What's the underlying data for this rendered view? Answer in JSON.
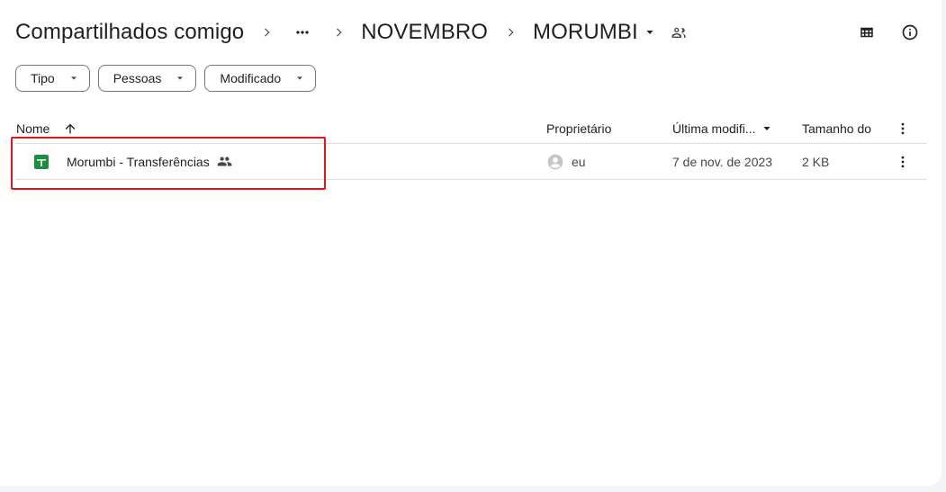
{
  "breadcrumb": {
    "root": "Compartilhados comigo",
    "more_label": "...",
    "folder1": "NOVEMBRO",
    "folder2": "MORUMBI"
  },
  "header_actions": {
    "grid_view_icon": "grid-view-icon",
    "details_icon": "info-icon"
  },
  "filters": [
    {
      "label": "Tipo"
    },
    {
      "label": "Pessoas"
    },
    {
      "label": "Modificado"
    }
  ],
  "table": {
    "columns": {
      "name": "Nome",
      "owner": "Proprietário",
      "modified": "Última modifi...",
      "size": "Tamanho do"
    },
    "rows": [
      {
        "name": "Morumbi - Transferências",
        "file_icon": "google-sheets-icon",
        "shared": true,
        "owner": "eu",
        "modified": "7 de nov. de 2023",
        "size": "2 KB"
      }
    ]
  },
  "colors": {
    "sheets_green": "#1e8e3e",
    "highlight_red": "#e0161b",
    "divider": "#dadce0"
  }
}
